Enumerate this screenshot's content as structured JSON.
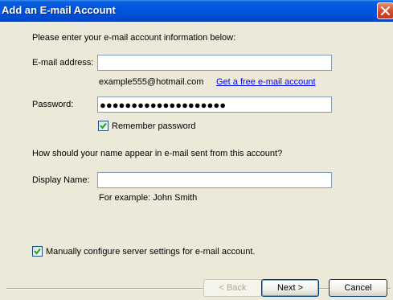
{
  "window": {
    "title": "Add an E-mail Account"
  },
  "intro": "Please enter your e-mail account information below:",
  "email": {
    "label": "E-mail address:",
    "value": "",
    "example": "example555@hotmail.com",
    "free_link": "Get a free e-mail account"
  },
  "password": {
    "label": "Password:",
    "masked": "●●●●●●●●●●●●●●●●●●●●",
    "remember_label": "Remember password",
    "remember_checked": true
  },
  "display": {
    "question": "How should your name appear in e-mail sent from this account?",
    "label": "Display Name:",
    "value": "",
    "example": "For example: John Smith"
  },
  "manual": {
    "label": "Manually configure server settings for e-mail account.",
    "checked": true
  },
  "buttons": {
    "back": "< Back",
    "next": "Next >",
    "cancel": "Cancel"
  },
  "colors": {
    "titlebar": "#0054e3",
    "link": "#0000ff",
    "dialog_bg": "#ece9d8"
  }
}
